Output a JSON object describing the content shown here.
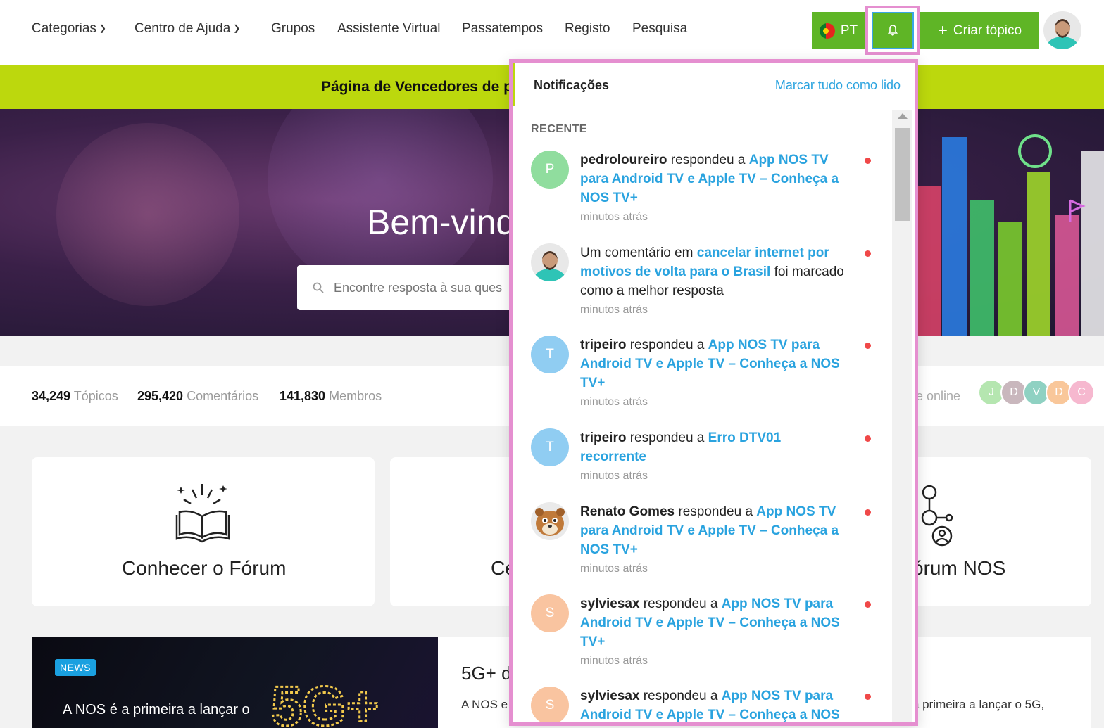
{
  "nav": {
    "items": [
      {
        "label": "Categorias",
        "dropdown": true
      },
      {
        "label": "Centro de Ajuda",
        "dropdown": true
      },
      {
        "label": "Grupos"
      },
      {
        "label": "Assistente Virtual"
      },
      {
        "label": "Passatempos"
      },
      {
        "label": "Registo"
      },
      {
        "label": "Pesquisa"
      }
    ],
    "language_label": "PT",
    "create_topic_label": "Criar tópico",
    "brand_color": "#5fb526",
    "highlight_color": "#e58fd0"
  },
  "banner": {
    "text": "Página de Vencedores de p",
    "color": "#bcd80d"
  },
  "hero": {
    "title": "Bem-vind",
    "search_placeholder": "Encontre resposta à sua ques"
  },
  "stats": {
    "topics_count": "34,249",
    "topics_label": "Tópicos",
    "comments_count": "295,420",
    "comments_label": "Comentários",
    "members_count": "141,830",
    "members_label": "Membros",
    "online_label": "te online",
    "online_users": [
      {
        "initial": "J",
        "color": "#b5e6b0"
      },
      {
        "initial": "D",
        "color": "#c9b7bd"
      },
      {
        "initial": "V",
        "color": "#8fd1c2"
      },
      {
        "initial": "D",
        "color": "#f9c79a"
      },
      {
        "initial": "C",
        "color": "#f6b8cf"
      }
    ]
  },
  "cards": [
    {
      "title": "Conhecer o Fórum",
      "icon": "book-sparkle-icon"
    },
    {
      "title": "Ce",
      "icon": ""
    },
    {
      "title": "órum NOS",
      "icon": "network-people-icon"
    }
  ],
  "news": {
    "badge": "NEWS",
    "image_text": "A NOS é a primeira a lançar o",
    "title": "5G+ d",
    "excerpt_left": "A NOS e",
    "excerpt_right": "a primeira a lançar o 5G,"
  },
  "notifications": {
    "title": "Notificações",
    "mark_all_label": "Marcar tudo como lido",
    "section_label": "RECENTE",
    "items": [
      {
        "avatar_initial": "P",
        "avatar_color": "#90dd9e",
        "user": "pedroloureiro",
        "action": " respondeu a ",
        "link": "App NOS TV para Android TV e Apple TV – Conheça a NOS TV+",
        "after": "",
        "time": "minutos atrás",
        "unread": true
      },
      {
        "avatar_initial": "",
        "avatar_color": "#2ec4b6",
        "user": "",
        "action": "Um comentário em ",
        "link": "cancelar internet por motivos de volta para o Brasil",
        "after": " foi marcado como a melhor resposta",
        "time": "minutos atrás",
        "unread": true
      },
      {
        "avatar_initial": "T",
        "avatar_color": "#90cdf2",
        "user": "tripeiro",
        "action": " respondeu a ",
        "link": "App NOS TV para Android TV e Apple TV – Conheça a NOS TV+",
        "after": "",
        "time": "minutos atrás",
        "unread": true
      },
      {
        "avatar_initial": "T",
        "avatar_color": "#90cdf2",
        "user": "tripeiro",
        "action": " respondeu a ",
        "link": "Erro DTV01 recorrente",
        "after": "",
        "time": "minutos atrás",
        "unread": true
      },
      {
        "avatar_initial": "",
        "avatar_color": "#b06a2c",
        "user": "Renato Gomes",
        "action": " respondeu a ",
        "link": "App NOS TV para Android TV e Apple TV – Conheça a NOS TV+",
        "after": "",
        "time": "minutos atrás",
        "unread": true
      },
      {
        "avatar_initial": "S",
        "avatar_color": "#f9c4a0",
        "user": "sylviesax",
        "action": " respondeu a ",
        "link": "App NOS TV para Android TV e Apple TV – Conheça a NOS TV+",
        "after": "",
        "time": "minutos atrás",
        "unread": true
      },
      {
        "avatar_initial": "S",
        "avatar_color": "#f9c4a0",
        "user": "sylviesax",
        "action": " respondeu a ",
        "link": "App NOS TV para Android TV e Apple TV – Conheça a NOS",
        "after": "",
        "time": "",
        "unread": true
      }
    ]
  }
}
